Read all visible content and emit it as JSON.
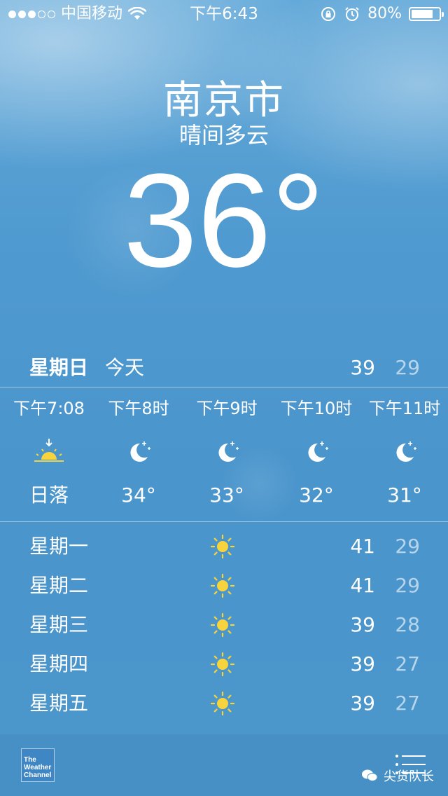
{
  "status_bar": {
    "carrier": "中国移动",
    "time": "下午6:43",
    "battery": "80%",
    "battery_level": 0.8,
    "signal_bars_filled": 3,
    "signal_bars_total": 5,
    "icons": [
      "wifi-icon",
      "rotation-lock-icon",
      "alarm-icon",
      "battery-icon"
    ]
  },
  "location": {
    "city": "南京市",
    "condition": "晴间多云",
    "temperature": "36°"
  },
  "today": {
    "day": "星期日",
    "label": "今天",
    "high": "39",
    "low": "29"
  },
  "hourly": [
    {
      "time": "下午7:08",
      "icon": "sunset-icon",
      "value": "日落"
    },
    {
      "time": "下午8时",
      "icon": "moon-icon",
      "value": "34°"
    },
    {
      "time": "下午9时",
      "icon": "moon-icon",
      "value": "33°"
    },
    {
      "time": "下午10时",
      "icon": "moon-icon",
      "value": "32°"
    },
    {
      "time": "下午11时",
      "icon": "moon-icon",
      "value": "31°"
    }
  ],
  "daily": [
    {
      "day": "星期一",
      "icon": "sun-icon",
      "high": "41",
      "low": "29"
    },
    {
      "day": "星期二",
      "icon": "sun-icon",
      "high": "41",
      "low": "29"
    },
    {
      "day": "星期三",
      "icon": "sun-icon",
      "high": "39",
      "low": "28"
    },
    {
      "day": "星期四",
      "icon": "sun-icon",
      "high": "39",
      "low": "27"
    },
    {
      "day": "星期五",
      "icon": "sun-icon",
      "high": "39",
      "low": "27"
    }
  ],
  "footer": {
    "logo_text": "The Weather Channel",
    "logo_lines": [
      "The",
      "Weather",
      "Channel"
    ],
    "watermark": "尖货队长"
  },
  "colors": {
    "sky_top": "#63a9d9",
    "sky_bottom": "#4b96cb",
    "sun": "#f7d43b",
    "text": "#ffffff"
  }
}
